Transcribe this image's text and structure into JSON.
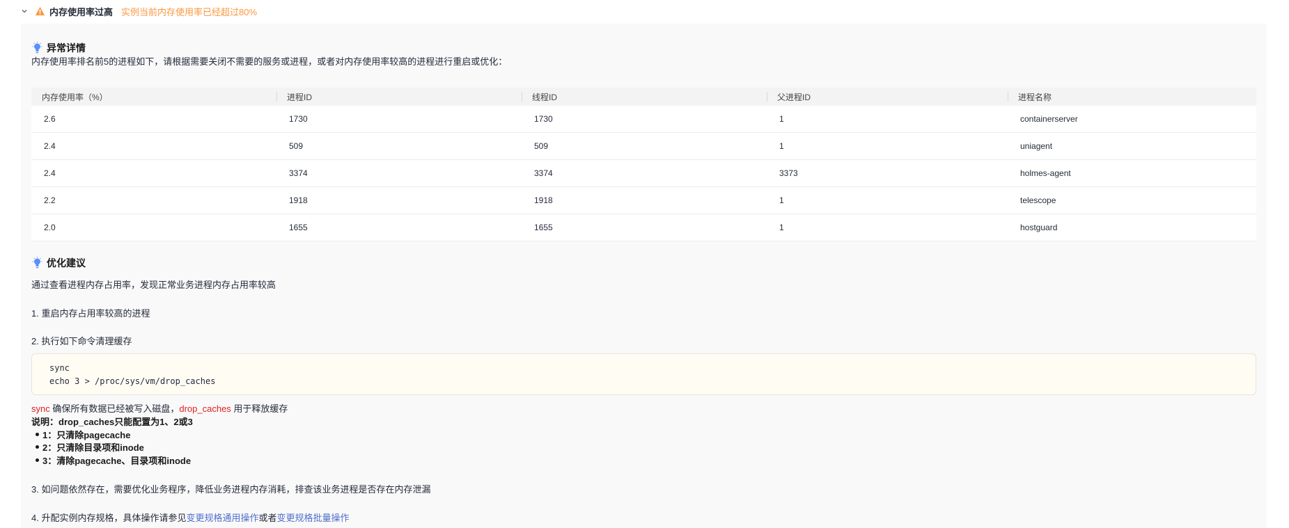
{
  "alert": {
    "title": "内存使用率过高",
    "message": "实例当前内存使用率已经超过80%"
  },
  "details": {
    "title": "异常详情",
    "description": "内存使用率排名前5的进程如下，请根据需要关闭不需要的服务或进程，或者对内存使用率较高的进程进行重启或优化："
  },
  "table": {
    "columns": [
      "内存使用率（%）",
      "进程ID",
      "线程ID",
      "父进程ID",
      "进程名称"
    ],
    "rows": [
      [
        "2.6",
        "1730",
        "1730",
        "1",
        "containerserver"
      ],
      [
        "2.4",
        "509",
        "509",
        "1",
        "uniagent"
      ],
      [
        "2.4",
        "3374",
        "3374",
        "3373",
        "holmes-agent"
      ],
      [
        "2.2",
        "1918",
        "1918",
        "1",
        "telescope"
      ],
      [
        "2.0",
        "1655",
        "1655",
        "1",
        "hostguard"
      ]
    ]
  },
  "suggestions": {
    "title": "优化建议",
    "intro": "通过查看进程内存占用率，发现正常业务进程内存占用率较高",
    "step1": "1. 重启内存占用率较高的进程",
    "step2": "2. 执行如下命令清理缓存",
    "code_lines": [
      "sync",
      "echo 3 > /proc/sys/vm/drop_caches"
    ],
    "note_sync": "sync",
    "note_mid": " 确保所有数据已经被写入磁盘，",
    "note_drop": "drop_caches",
    "note_end": " 用于释放缓存",
    "explain": "说明：drop_caches只能配置为1、2或3",
    "options": [
      "1：只清除pagecache",
      "2：只清除目录项和inode",
      "3：清除pagecache、目录项和inode"
    ],
    "step3": "3. 如问题依然存在，需要优化业务程序，降低业务进程内存消耗，排查该业务进程是否存在内存泄漏",
    "step4_prefix": "4. 升配实例内存规格，具体操作请参见",
    "step4_link1": "变更规格通用操作",
    "step4_mid": "或者",
    "step4_link2": "变更规格批量操作"
  },
  "colors": {
    "warning": "#fa9841",
    "accent_red": "#e02020",
    "link": "#526ecc",
    "bulb": "#5b8ff9"
  }
}
